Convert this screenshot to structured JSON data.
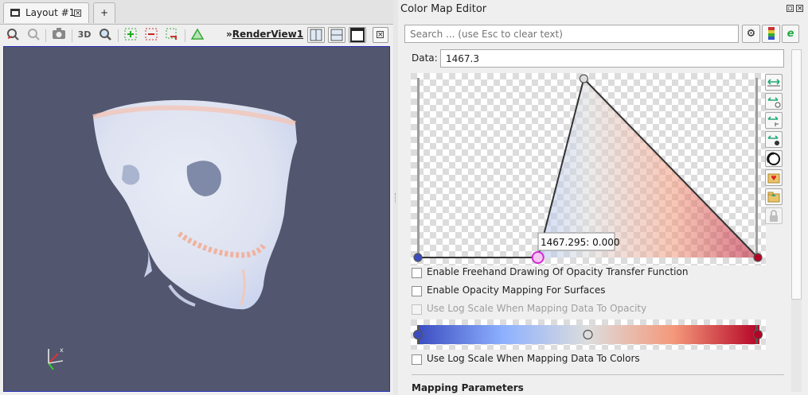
{
  "layout_tab": {
    "label": "Layout #1",
    "add_label": "+"
  },
  "toolbar": {
    "threed_label": "3D",
    "view_prefix": "»",
    "view_name": "RenderView1"
  },
  "editor": {
    "title": "Color Map Editor",
    "search_placeholder": "Search ... (use Esc to clear text)",
    "data_label": "Data:",
    "data_value": "1467.3",
    "tooltip": "1467.295: 0.000",
    "opacity_points": [
      {
        "x": 0.0,
        "y": 0.0
      },
      {
        "x": 0.353,
        "y": 0.0
      },
      {
        "x": 0.488,
        "y": 1.0
      },
      {
        "x": 1.0,
        "y": 0.0
      }
    ],
    "selected_point": 1,
    "options": [
      {
        "label": "Enable Freehand Drawing Of Opacity Transfer Function",
        "checked": false,
        "enabled": true
      },
      {
        "label": "Enable Opacity Mapping For Surfaces",
        "checked": false,
        "enabled": true
      },
      {
        "label": "Use Log Scale When Mapping Data To Opacity",
        "checked": false,
        "enabled": false
      }
    ],
    "color_log_option": {
      "label": "Use Log Scale When Mapping Data To Colors",
      "checked": false,
      "enabled": true
    },
    "colormap": [
      "#3b4cc0",
      "#8db0fe",
      "#dddddd",
      "#f4987a",
      "#b40426"
    ],
    "color_points": [
      0.0,
      0.5,
      1.0
    ],
    "section_label": "Mapping Parameters"
  }
}
